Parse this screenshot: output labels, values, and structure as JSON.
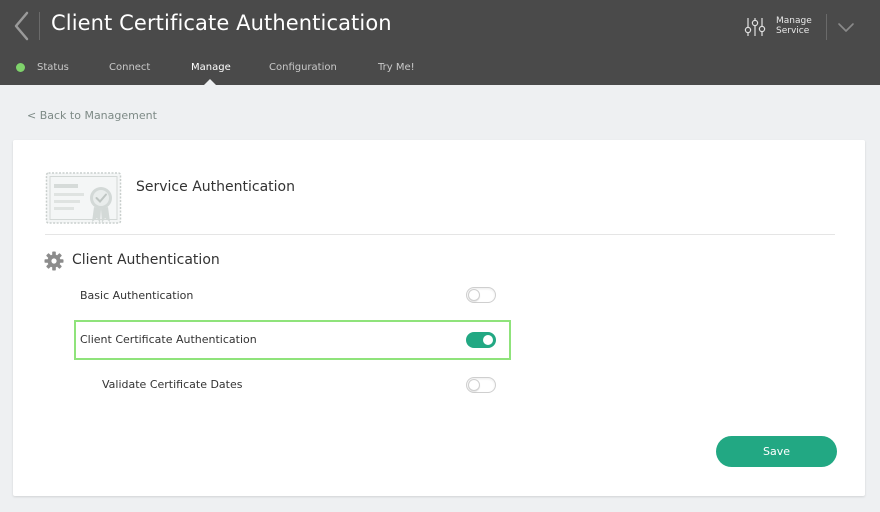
{
  "header": {
    "title": "Client Certificate Authentication",
    "manage_service_line1": "Manage",
    "manage_service_line2": "Service",
    "back_icon": "chevron-left-icon",
    "menu_icon": "chevron-down-icon",
    "manage_icon": "sliders-icon"
  },
  "tabs": [
    {
      "label": "Status",
      "active": false
    },
    {
      "label": "Connect",
      "active": false
    },
    {
      "label": "Manage",
      "active": true
    },
    {
      "label": "Configuration",
      "active": false
    },
    {
      "label": "Try Me!",
      "active": false
    }
  ],
  "status_color": "#7fd36b",
  "back_link": "< Back to Management",
  "card": {
    "title": "Service Authentication",
    "section_title": "Client Authentication",
    "settings": [
      {
        "label": "Basic Authentication",
        "enabled": false
      },
      {
        "label": "Client Certificate Authentication",
        "enabled": true
      },
      {
        "label": "Validate Certificate Dates",
        "enabled": false
      }
    ],
    "save_label": "Save"
  },
  "colors": {
    "header_bg": "#4a4a4a",
    "accent": "#22a883",
    "highlight": "#8fe37b"
  }
}
